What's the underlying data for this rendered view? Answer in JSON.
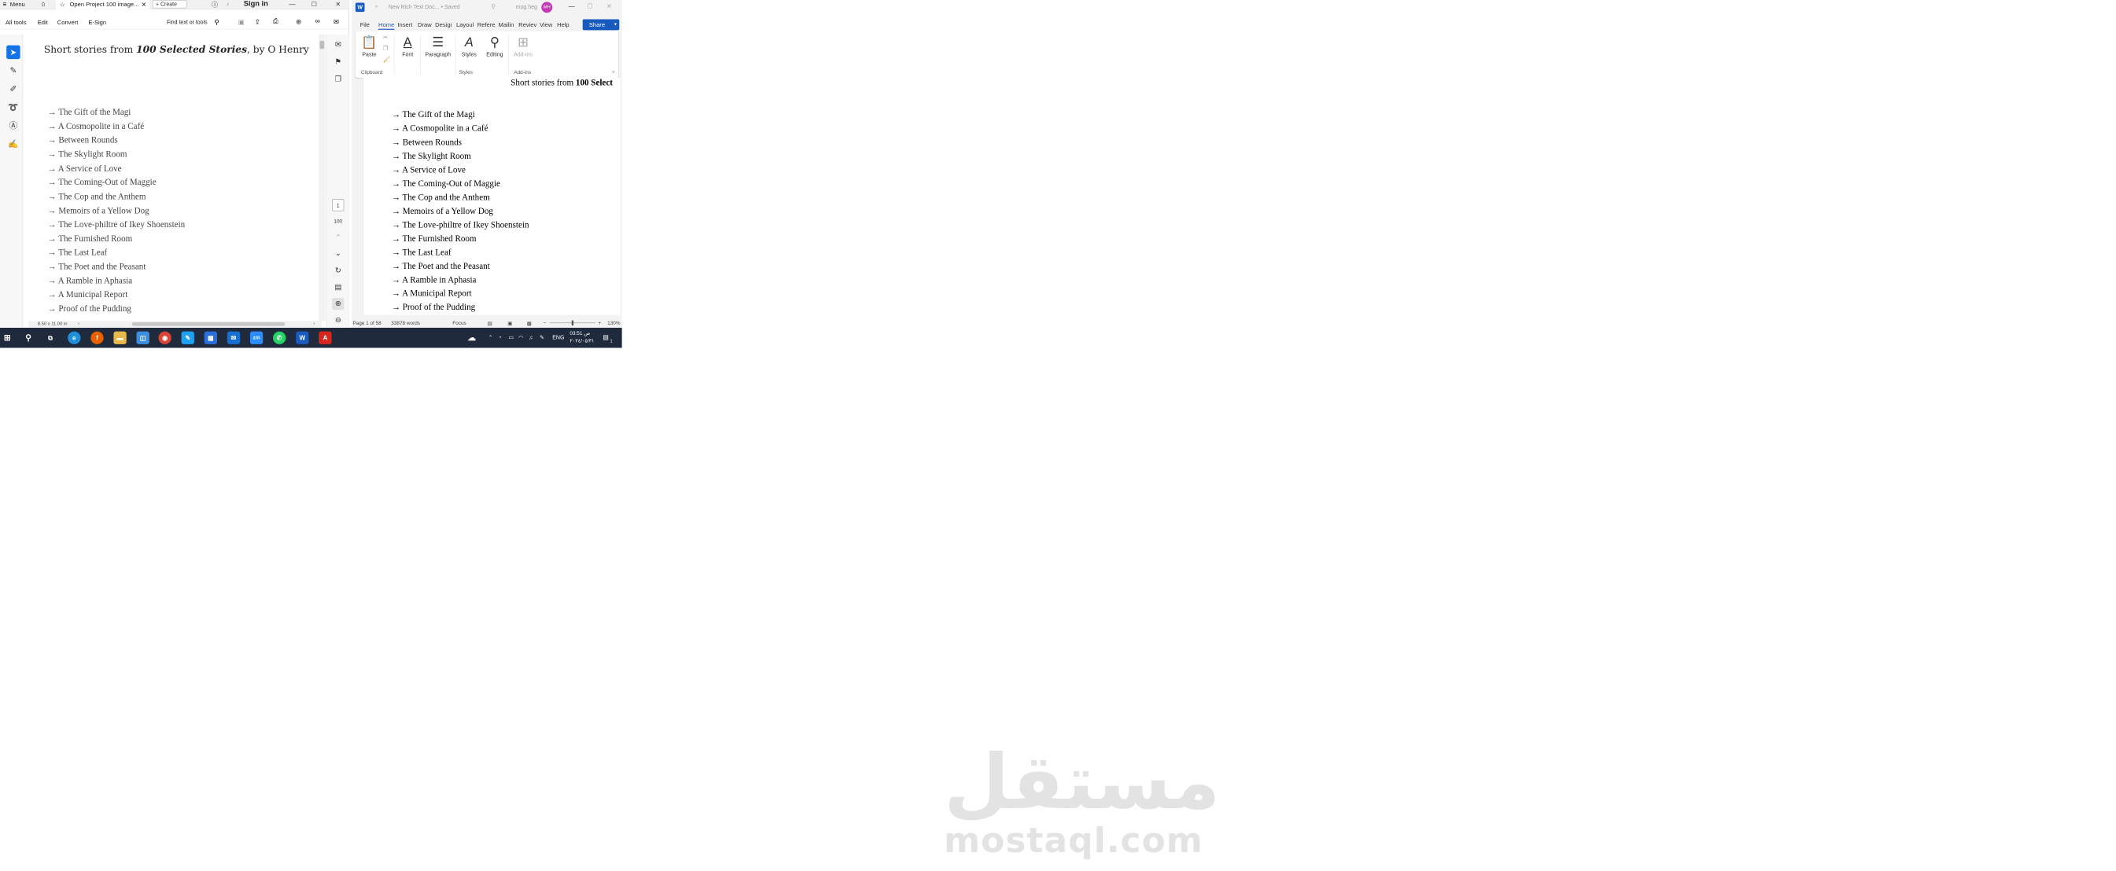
{
  "acrobat": {
    "menu_label": "Menu",
    "tab_title": "Open Project 100 image...",
    "create_label": "+ Create",
    "signin_label": "Sign in",
    "menus": [
      "All tools",
      "Edit",
      "Convert",
      "E-Sign"
    ],
    "find_label": "Find text or tools",
    "doc_title_pre": "Short stories from ",
    "doc_title_italic": "100 Selected Stories",
    "doc_title_post": ", by O Henry",
    "stories": [
      "→  The Gift of the Magi",
      "→  A Cosmopolite in a Café",
      "→  Between Rounds",
      "→  The Skylight Room",
      "→  A Service of Love",
      "→  The Coming-Out of Maggie",
      "→  The Cop and the Anthem",
      "→  Memoirs of a Yellow Dog",
      "→  The Love-philtre of Ikey Shoenstein",
      "→  The Furnished Room",
      "→  The Last Leaf",
      "→  The Poet and the Peasant",
      "→  A Ramble in Aphasia",
      "→  A Municipal Report",
      "→  Proof of the Pudding"
    ],
    "page_number": "1",
    "page_count": "100",
    "page_size": "8.50 x 11.00 in"
  },
  "word": {
    "title": "New Rich Text Doc... • Saved",
    "user": "mog heg",
    "avatar": "MH",
    "tabs": [
      "File",
      "Home",
      "Insert",
      "Draw",
      "Design",
      "Layout",
      "References",
      "Mailings",
      "Review",
      "View",
      "Help"
    ],
    "tab_display": [
      "File",
      "Home",
      "Insert",
      "Draw",
      "Desigı",
      "Layoul",
      "Refere",
      "Mailin",
      "Reviev",
      "View",
      "Help"
    ],
    "share_label": "Share",
    "ribbon": {
      "paste": "Paste",
      "font": "Font",
      "paragraph": "Paragraph",
      "styles": "Styles",
      "editing": "Editing",
      "addins": "Add-ins",
      "group_clipboard": "Clipboard",
      "group_styles": "Styles",
      "group_addins": "Add-ins"
    },
    "heading_pre": "Short stories from ",
    "heading_bold": "100 Select",
    "stories": [
      "→ The Gift of the Magi",
      "→ A Cosmopolite in a Café",
      "→ Between Rounds",
      "→ The Skylight Room",
      "→ A Service of Love",
      "→ The Coming-Out of Maggie",
      "→ The Cop and the Anthem",
      "→ Memoirs of a Yellow Dog",
      "→ The Love-philtre of Ikey Shoenstein",
      "→ The Furnished Room",
      "→ The Last Leaf",
      "→ The Poet and the Peasant",
      "→ A Ramble in Aphasia",
      "→ A Municipal Report",
      "→ Proof of the Pudding"
    ],
    "status_page": "Page 1 of 58",
    "status_words": "33878 words",
    "status_focus": "Focus",
    "zoom": "130%"
  },
  "taskbar": {
    "lang": "ENG",
    "time": "03:51 ص",
    "date": "٢٠٢٤/٠٥/٣١",
    "notifications": "1"
  },
  "watermark": {
    "arabic": "مستقل",
    "latin": "mostaql.com"
  },
  "colors": {
    "word_accent": "#185abd",
    "acrobat_red": "#d7261e",
    "avatar": "#c239b3",
    "taskbar": "#1f2b3d"
  }
}
